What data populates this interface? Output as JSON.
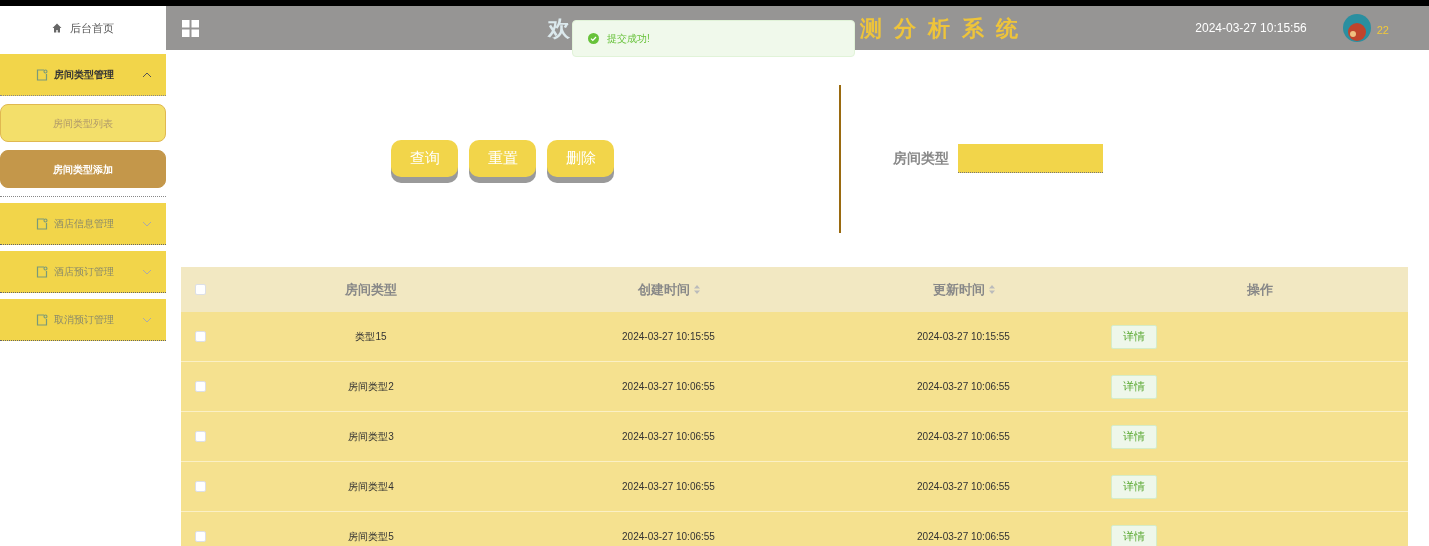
{
  "sidebar": {
    "home": "后台首页",
    "menus": [
      {
        "label": "房间类型管理",
        "expanded": true,
        "children": [
          {
            "label": "房间类型列表",
            "selected": false
          },
          {
            "label": "房间类型添加",
            "selected": true
          }
        ]
      },
      {
        "label": "酒店信息管理",
        "expanded": false
      },
      {
        "label": "酒店预订管理",
        "expanded": false
      },
      {
        "label": "取消预订管理",
        "expanded": false
      }
    ]
  },
  "header": {
    "title_start": "欢",
    "title_end": "测分析系统",
    "datetime": "2024-03-27 10:15:56",
    "user_badge": "22"
  },
  "toast": {
    "message": "提交成功!"
  },
  "actions": [
    "查询",
    "重置",
    "删除"
  ],
  "search": {
    "label": "房间类型"
  },
  "table": {
    "select_all_checked": false,
    "columns": [
      {
        "label": "房间类型",
        "sortable": false
      },
      {
        "label": "创建时间",
        "sortable": true
      },
      {
        "label": "更新时间",
        "sortable": true
      },
      {
        "label": "操作",
        "sortable": false
      }
    ],
    "rows": [
      {
        "checked": false,
        "type": "类型15",
        "created": "2024-03-27 10:15:55",
        "updated": "2024-03-27 10:15:55",
        "action": "详情"
      },
      {
        "checked": false,
        "type": "房间类型2",
        "created": "2024-03-27 10:06:55",
        "updated": "2024-03-27 10:06:55",
        "action": "详情"
      },
      {
        "checked": false,
        "type": "房间类型3",
        "created": "2024-03-27 10:06:55",
        "updated": "2024-03-27 10:06:55",
        "action": "详情"
      },
      {
        "checked": false,
        "type": "房间类型4",
        "created": "2024-03-27 10:06:55",
        "updated": "2024-03-27 10:06:55",
        "action": "详情"
      },
      {
        "checked": false,
        "type": "房间类型5",
        "created": "2024-03-27 10:06:55",
        "updated": "2024-03-27 10:06:55",
        "action": "详情"
      }
    ]
  }
}
